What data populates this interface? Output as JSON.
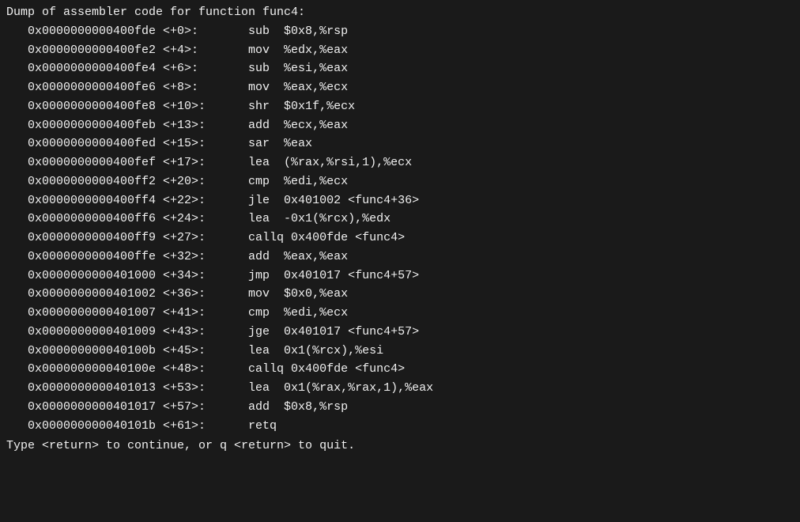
{
  "terminal": {
    "header": "Dump of assembler code for function func4:",
    "instructions": [
      {
        "addr": "0x0000000000400fde",
        "offset": "<+0>:",
        "mnemonic": "sub",
        "operands": "  $0x8,%rsp"
      },
      {
        "addr": "0x0000000000400fe2",
        "offset": "<+4>:",
        "mnemonic": "mov",
        "operands": "  %edx,%eax"
      },
      {
        "addr": "0x0000000000400fe4",
        "offset": "<+6>:",
        "mnemonic": "sub",
        "operands": "  %esi,%eax"
      },
      {
        "addr": "0x0000000000400fe6",
        "offset": "<+8>:",
        "mnemonic": "mov",
        "operands": "  %eax,%ecx"
      },
      {
        "addr": "0x0000000000400fe8",
        "offset": "<+10>:",
        "mnemonic": "shr",
        "operands": "  $0x1f,%ecx"
      },
      {
        "addr": "0x0000000000400feb",
        "offset": "<+13>:",
        "mnemonic": "add",
        "operands": "  %ecx,%eax"
      },
      {
        "addr": "0x0000000000400fed",
        "offset": "<+15>:",
        "mnemonic": "sar",
        "operands": "  %eax"
      },
      {
        "addr": "0x0000000000400fef",
        "offset": "<+17>:",
        "mnemonic": "lea",
        "operands": "  (%rax,%rsi,1),%ecx"
      },
      {
        "addr": "0x0000000000400ff2",
        "offset": "<+20>:",
        "mnemonic": "cmp",
        "operands": "  %edi,%ecx"
      },
      {
        "addr": "0x0000000000400ff4",
        "offset": "<+22>:",
        "mnemonic": "jle",
        "operands": "  0x401002 <func4+36>"
      },
      {
        "addr": "0x0000000000400ff6",
        "offset": "<+24>:",
        "mnemonic": "lea",
        "operands": "  -0x1(%rcx),%edx"
      },
      {
        "addr": "0x0000000000400ff9",
        "offset": "<+27>:",
        "mnemonic": "callq",
        "operands": "0x400fde <func4>"
      },
      {
        "addr": "0x0000000000400ffe",
        "offset": "<+32>:",
        "mnemonic": "add",
        "operands": "  %eax,%eax"
      },
      {
        "addr": "0x0000000000401000",
        "offset": "<+34>:",
        "mnemonic": "jmp",
        "operands": "  0x401017 <func4+57>"
      },
      {
        "addr": "0x0000000000401002",
        "offset": "<+36>:",
        "mnemonic": "mov",
        "operands": "  $0x0,%eax"
      },
      {
        "addr": "0x0000000000401007",
        "offset": "<+41>:",
        "mnemonic": "cmp",
        "operands": "  %edi,%ecx"
      },
      {
        "addr": "0x0000000000401009",
        "offset": "<+43>:",
        "mnemonic": "jge",
        "operands": "  0x401017 <func4+57>"
      },
      {
        "addr": "0x000000000040100b",
        "offset": "<+45>:",
        "mnemonic": "lea",
        "operands": "  0x1(%rcx),%esi"
      },
      {
        "addr": "0x000000000040100e",
        "offset": "<+48>:",
        "mnemonic": "callq",
        "operands": "0x400fde <func4>"
      },
      {
        "addr": "0x0000000000401013",
        "offset": "<+53>:",
        "mnemonic": "lea",
        "operands": "  0x1(%rax,%rax,1),%eax"
      },
      {
        "addr": "0x0000000000401017",
        "offset": "<+57>:",
        "mnemonic": "add",
        "operands": "  $0x8,%rsp"
      },
      {
        "addr": "0x000000000040101b",
        "offset": "<+61>:",
        "mnemonic": "retq",
        "operands": ""
      }
    ],
    "footer": "Type <return> to continue, or q <return> to quit."
  }
}
